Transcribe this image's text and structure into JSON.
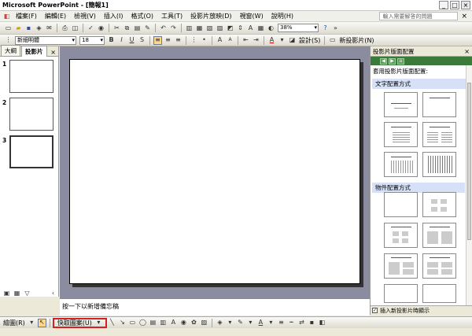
{
  "window": {
    "title": "Microsoft PowerPoint - [簡報1]",
    "min": "_",
    "max": "□",
    "close": "×"
  },
  "menu": {
    "items": [
      "檔案(F)",
      "編輯(E)",
      "檢視(V)",
      "插入(I)",
      "格式(O)",
      "工具(T)",
      "投影片放映(D)",
      "視窗(W)",
      "說明(H)"
    ],
    "help_placeholder": "輸入需要解答的問題",
    "close": "×"
  },
  "toolbar": {
    "zoom": "38%"
  },
  "format": {
    "font": "新細明體",
    "size": "18",
    "bold": "B",
    "italic": "I",
    "underline": "U",
    "shadow": "S",
    "design": "設計(S)",
    "new_slide": "新投影片(N)"
  },
  "left_panel": {
    "tabs": [
      "大綱",
      "投影片"
    ],
    "close": "×",
    "slides": [
      "1",
      "2",
      "3"
    ]
  },
  "notes": {
    "text": "按一下以新增備忘稿"
  },
  "task_pane": {
    "title": "投影片版面配置",
    "close": "×",
    "subtitle": "套用投影片版面配置:",
    "sections": [
      "文字配置方式",
      "物件配置方式"
    ],
    "insert_check": "插入新投影片時顯示"
  },
  "drawing": {
    "draw_label": "繪圖(R)",
    "autoshape_label": "快取圖案(U)"
  }
}
